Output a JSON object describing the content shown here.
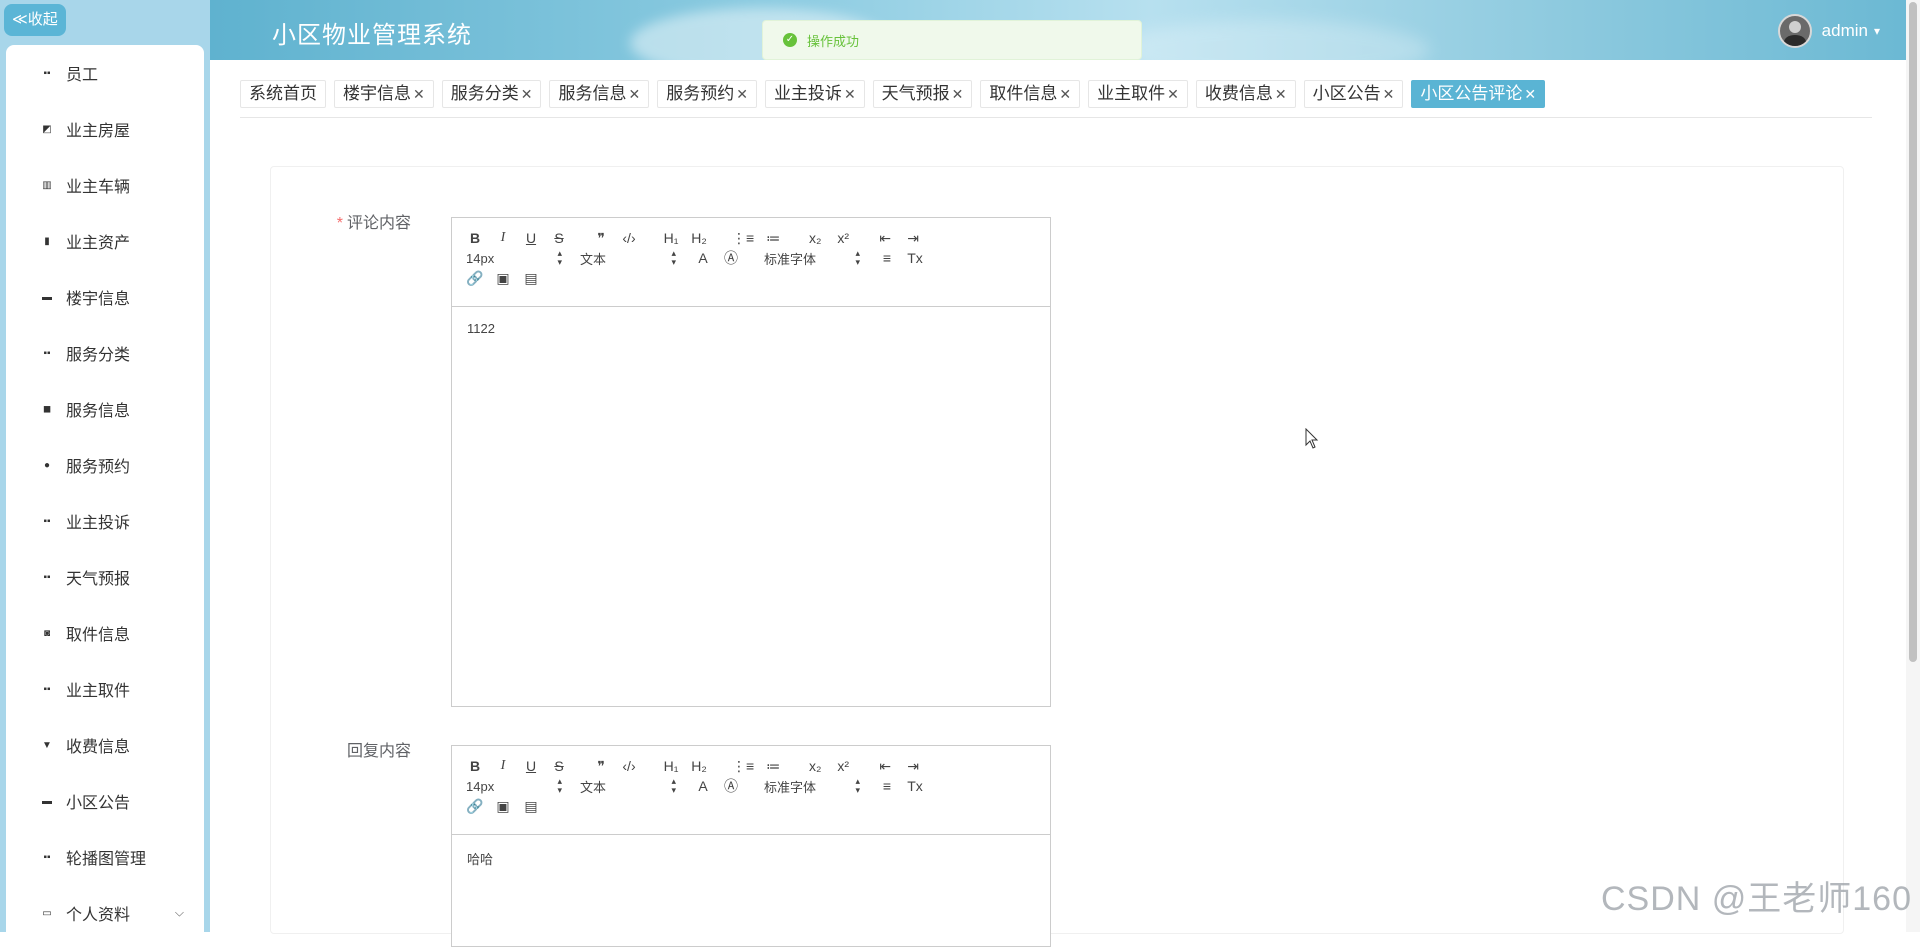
{
  "sidebar": {
    "collapse_label": "≪收起",
    "items": [
      {
        "label": "员工",
        "icon": "grid-icon"
      },
      {
        "label": "业主房屋",
        "icon": "chart-icon"
      },
      {
        "label": "业主车辆",
        "icon": "building-icon"
      },
      {
        "label": "业主资产",
        "icon": "bar-chart-icon"
      },
      {
        "label": "楼宇信息",
        "icon": "monitor-icon"
      },
      {
        "label": "服务分类",
        "icon": "grid-icon"
      },
      {
        "label": "服务信息",
        "icon": "video-icon"
      },
      {
        "label": "服务预约",
        "icon": "pin-icon"
      },
      {
        "label": "业主投诉",
        "icon": "grid-icon"
      },
      {
        "label": "天气预报",
        "icon": "grid-icon"
      },
      {
        "label": "取件信息",
        "icon": "clipboard-icon"
      },
      {
        "label": "业主取件",
        "icon": "grid-icon"
      },
      {
        "label": "收费信息",
        "icon": "stamp-icon"
      },
      {
        "label": "小区公告",
        "icon": "print-icon"
      },
      {
        "label": "轮播图管理",
        "icon": "grid-icon"
      },
      {
        "label": "个人资料",
        "icon": "card-icon"
      }
    ]
  },
  "header": {
    "title": "小区物业管理系统",
    "username": "admin",
    "caret": "⌄"
  },
  "toast": {
    "message": "操作成功"
  },
  "tabs": [
    {
      "label": "系统首页",
      "closable": false,
      "active": false
    },
    {
      "label": "楼宇信息",
      "closable": true,
      "active": false
    },
    {
      "label": "服务分类",
      "closable": true,
      "active": false
    },
    {
      "label": "服务信息",
      "closable": true,
      "active": false
    },
    {
      "label": "服务预约",
      "closable": true,
      "active": false
    },
    {
      "label": "业主投诉",
      "closable": true,
      "active": false
    },
    {
      "label": "天气预报",
      "closable": true,
      "active": false
    },
    {
      "label": "取件信息",
      "closable": true,
      "active": false
    },
    {
      "label": "业主取件",
      "closable": true,
      "active": false
    },
    {
      "label": "收费信息",
      "closable": true,
      "active": false
    },
    {
      "label": "小区公告",
      "closable": true,
      "active": false
    },
    {
      "label": "小区公告评论",
      "closable": true,
      "active": true
    }
  ],
  "form": {
    "comment": {
      "label": "评论内容",
      "required": true,
      "value": "1122"
    },
    "reply": {
      "label": "回复内容",
      "required": false,
      "value": "哈哈"
    },
    "toolbar": {
      "font_size": "14px",
      "header_type": "文本",
      "font_family": "标准字体",
      "bold": "B",
      "italic": "I",
      "underline": "U",
      "strike": "S",
      "blockquote": "❞",
      "code": "‹/›",
      "h1": "H₁",
      "h2": "H₂",
      "ordered_list": "⋮≡",
      "bullet_list": "≔",
      "subscript": "x₂",
      "superscript": "x²",
      "outdent": "⇤",
      "indent": "⇥",
      "font_color": "A",
      "background": "Ⓐ",
      "align": "≡",
      "clean": "Tx",
      "link": "🔗",
      "image": "▣",
      "video": "▤"
    }
  },
  "watermark": "CSDN @王老师160",
  "colors": {
    "accent": "#5ab4d4",
    "sidebar_bg": "#a8d6ea",
    "success": "#67c23a"
  }
}
